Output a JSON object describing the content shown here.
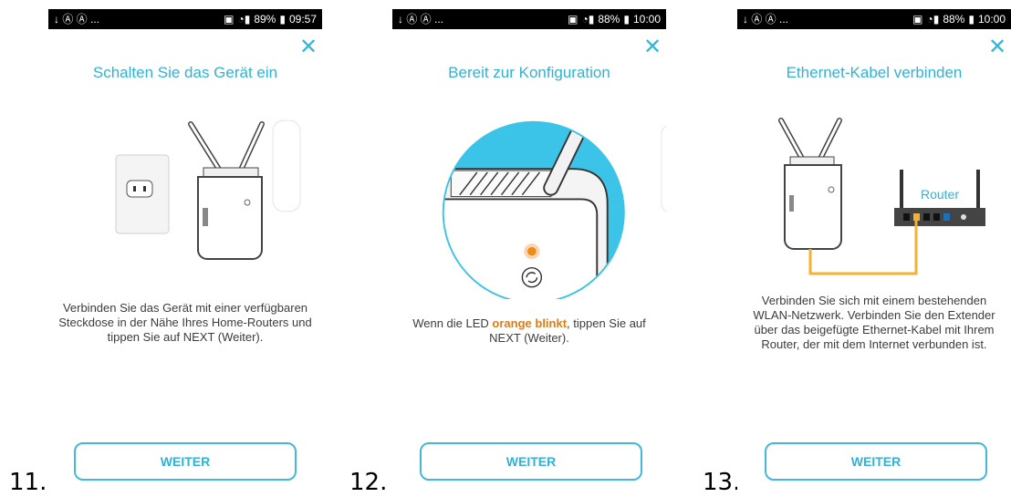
{
  "colors": {
    "accent": "#33b1d6",
    "led": "#f28a1a",
    "cable": "#f5b133"
  },
  "screens": [
    {
      "step": "11.",
      "status": {
        "left": "↓ Ⓐ Ⓐ ...",
        "battery": "89%",
        "time": "09:57"
      },
      "title": "Schalten Sie das Gerät ein",
      "text": "Verbinden Sie das Gerät mit einer verfügbaren Steckdose in der Nähe Ihres Home-Routers und tippen Sie auf NEXT (Weiter).",
      "button": "WEITER"
    },
    {
      "step": "12.",
      "status": {
        "left": "↓ Ⓐ Ⓐ ...",
        "battery": "88%",
        "time": "10:00"
      },
      "title": "Bereit zur Konfiguration",
      "text_before": "Wenn die LED ",
      "text_bold": "orange blinkt",
      "text_after": ", tippen Sie auf NEXT (Weiter).",
      "button": "WEITER"
    },
    {
      "step": "13.",
      "status": {
        "left": "↓ Ⓐ Ⓐ ...",
        "battery": "88%",
        "time": "10:00"
      },
      "title": "Ethernet-Kabel verbinden",
      "router_label": "Router",
      "text": "Verbinden Sie sich mit einem bestehenden WLAN-Netzwerk. Verbinden Sie den Extender über das beigefügte Ethernet-Kabel mit Ihrem Router, der mit dem Internet verbunden ist.",
      "button": "WEITER"
    }
  ]
}
